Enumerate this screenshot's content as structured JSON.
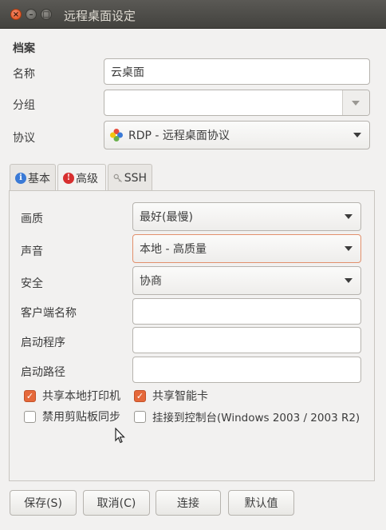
{
  "window": {
    "title": "远程桌面设定",
    "close_glyph": "×",
    "min_glyph": "–",
    "max_glyph": "□"
  },
  "profile": {
    "section_title": "档案",
    "name_label": "名称",
    "name_value": "云桌面",
    "group_label": "分组",
    "group_value": "",
    "protocol_label": "协议",
    "protocol_value": "RDP - 远程桌面协议"
  },
  "tabs": [
    {
      "label": "基本",
      "icon": "info-icon",
      "color": "#3a7ad6"
    },
    {
      "label": "高级",
      "icon": "warning-icon",
      "color": "#d72f2f"
    },
    {
      "label": "SSH",
      "icon": "key-icon",
      "color": "#9a9893"
    }
  ],
  "advanced": {
    "quality_label": "画质",
    "quality_value": "最好(最慢)",
    "sound_label": "声音",
    "sound_value": "本地 - 高质量",
    "security_label": "安全",
    "security_value": "协商",
    "client_name_label": "客户端名称",
    "client_name_value": "",
    "startup_program_label": "启动程序",
    "startup_program_value": "",
    "startup_path_label": "启动路径",
    "startup_path_value": "",
    "checkboxes": [
      {
        "label": "共享本地打印机",
        "checked": true
      },
      {
        "label": "共享智能卡",
        "checked": true
      },
      {
        "label": "禁用剪贴板同步",
        "checked": false
      },
      {
        "label": "挂接到控制台(Windows 2003 / 2003 R2)",
        "checked": false
      }
    ],
    "check_glyph": "✓"
  },
  "buttons": {
    "save": "保存(S)",
    "cancel": "取消(C)",
    "connect": "连接",
    "default": "默认值"
  },
  "colors": {
    "accent": "#e5683a",
    "titlebar": "#4a4945"
  }
}
